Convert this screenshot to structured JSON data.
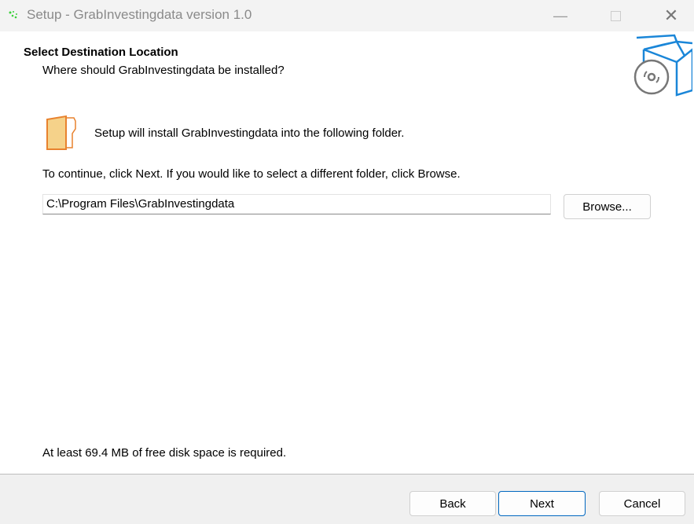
{
  "window": {
    "title": "Setup - GrabInvestingdata version 1.0",
    "icons": {
      "app": "setup-icon",
      "minimize": "minimize-icon",
      "maximize": "maximize-icon",
      "close": "close-icon"
    }
  },
  "header": {
    "title": "Select Destination Location",
    "subtitle": "Where should GrabInvestingdata be installed?",
    "icon": "box-with-disc-icon"
  },
  "main": {
    "folder_icon": "folder-icon",
    "install_text": "Setup will install GrabInvestingdata into the following folder.",
    "instructions": "To continue, click Next. If you would like to select a different folder, click Browse.",
    "path_value": "C:\\Program Files\\GrabInvestingdata",
    "browse_label": "Browse...",
    "disk_space": "At least 69.4 MB of free disk space is required."
  },
  "footer": {
    "back_label": "Back",
    "next_label": "Next",
    "cancel_label": "Cancel"
  }
}
